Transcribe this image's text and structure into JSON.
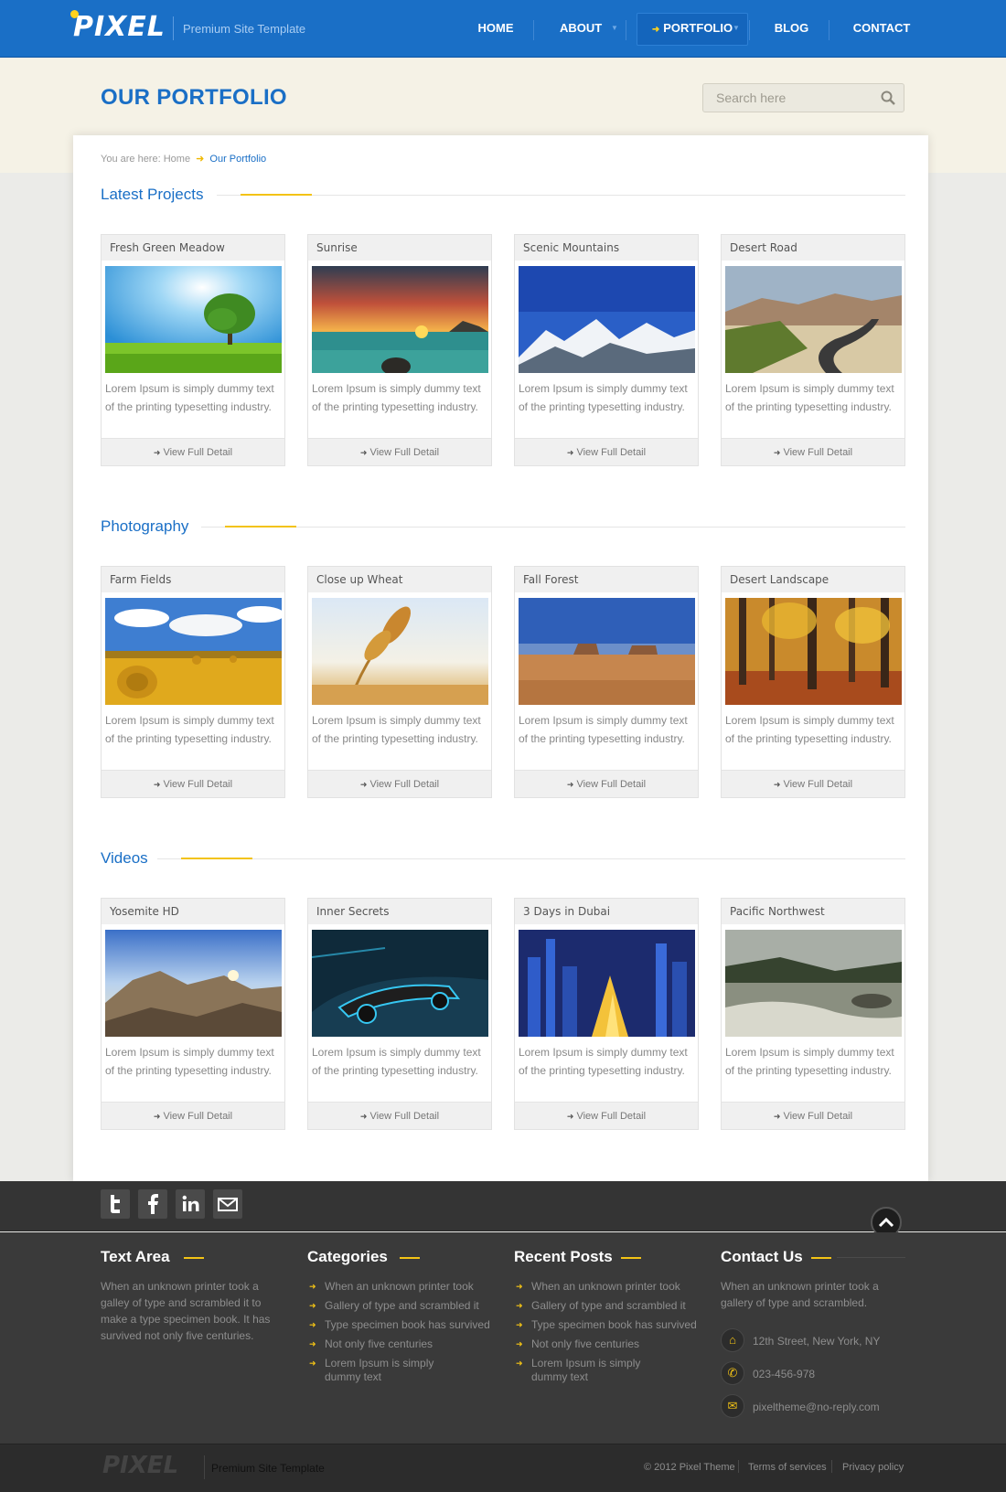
{
  "header": {
    "logo": "PIXEL",
    "tagline": "Premium Site Template",
    "nav": [
      "HOME",
      "ABOUT",
      "PORTFOLIO",
      "BLOG",
      "CONTACT"
    ]
  },
  "page": {
    "title": "OUR PORTFOLIO",
    "search_placeholder": "Search here"
  },
  "breadcrumb": {
    "prefix": "You are here:",
    "home": "Home",
    "current": "Our Portfolio"
  },
  "sections": [
    {
      "title": "Latest Projects",
      "items": [
        {
          "title": "Fresh Green Meadow",
          "image": "meadow"
        },
        {
          "title": "Sunrise",
          "image": "sunrise"
        },
        {
          "title": "Scenic Mountains",
          "image": "mountains"
        },
        {
          "title": "Desert Road",
          "image": "road"
        }
      ]
    },
    {
      "title": "Photography",
      "items": [
        {
          "title": "Farm Fields",
          "image": "farm"
        },
        {
          "title": "Close up Wheat",
          "image": "wheat"
        },
        {
          "title": "Fall Forest",
          "image": "mesa"
        },
        {
          "title": "Desert Landscape",
          "image": "forest"
        }
      ]
    },
    {
      "title": "Videos",
      "items": [
        {
          "title": "Yosemite HD",
          "image": "yosemite"
        },
        {
          "title": "Inner Secrets",
          "image": "racecar"
        },
        {
          "title": "3 Days in Dubai",
          "image": "dubai"
        },
        {
          "title": "Pacific Northwest",
          "image": "coast"
        }
      ]
    }
  ],
  "card_text": {
    "description": "Lorem Ipsum is simply dummy text of the printing typesetting industry.",
    "link": "View Full Detail"
  },
  "footer": {
    "social": [
      "twitter",
      "facebook",
      "linkedin",
      "email"
    ],
    "text_area": {
      "title": "Text Area",
      "body": "When an unknown printer took a galley of type and scrambled it to make a type specimen book. It has survived not only five centuries."
    },
    "categories": {
      "title": "Categories",
      "items": [
        "When an unknown printer took",
        "Gallery of type and scrambled it",
        "Type specimen book has survived",
        "Not only five centuries",
        "Lorem Ipsum is simply dummy text"
      ]
    },
    "recent_posts": {
      "title": "Recent Posts",
      "items": [
        "When an unknown printer took",
        "Gallery of type and scrambled it",
        "Type specimen book has survived",
        "Not only five centuries",
        "Lorem Ipsum is simply dummy text"
      ]
    },
    "contact": {
      "title": "Contact Us",
      "body": "When an unknown printer took a gallery of type and scrambled.",
      "address": "12th Street, New York, NY",
      "phone": "023-456-978",
      "email": "pixeltheme@no-reply.com"
    },
    "bottom": {
      "logo": "PIXEL",
      "tagline": "Premium Site Template",
      "copyright": "© 2012 Pixel Theme",
      "terms": "Terms of services",
      "privacy": "Privacy policy"
    }
  },
  "colors": {
    "brand_blue": "#1a6fc6",
    "accent_yellow": "#f3c315",
    "footer_dark": "#3a3a3a"
  }
}
